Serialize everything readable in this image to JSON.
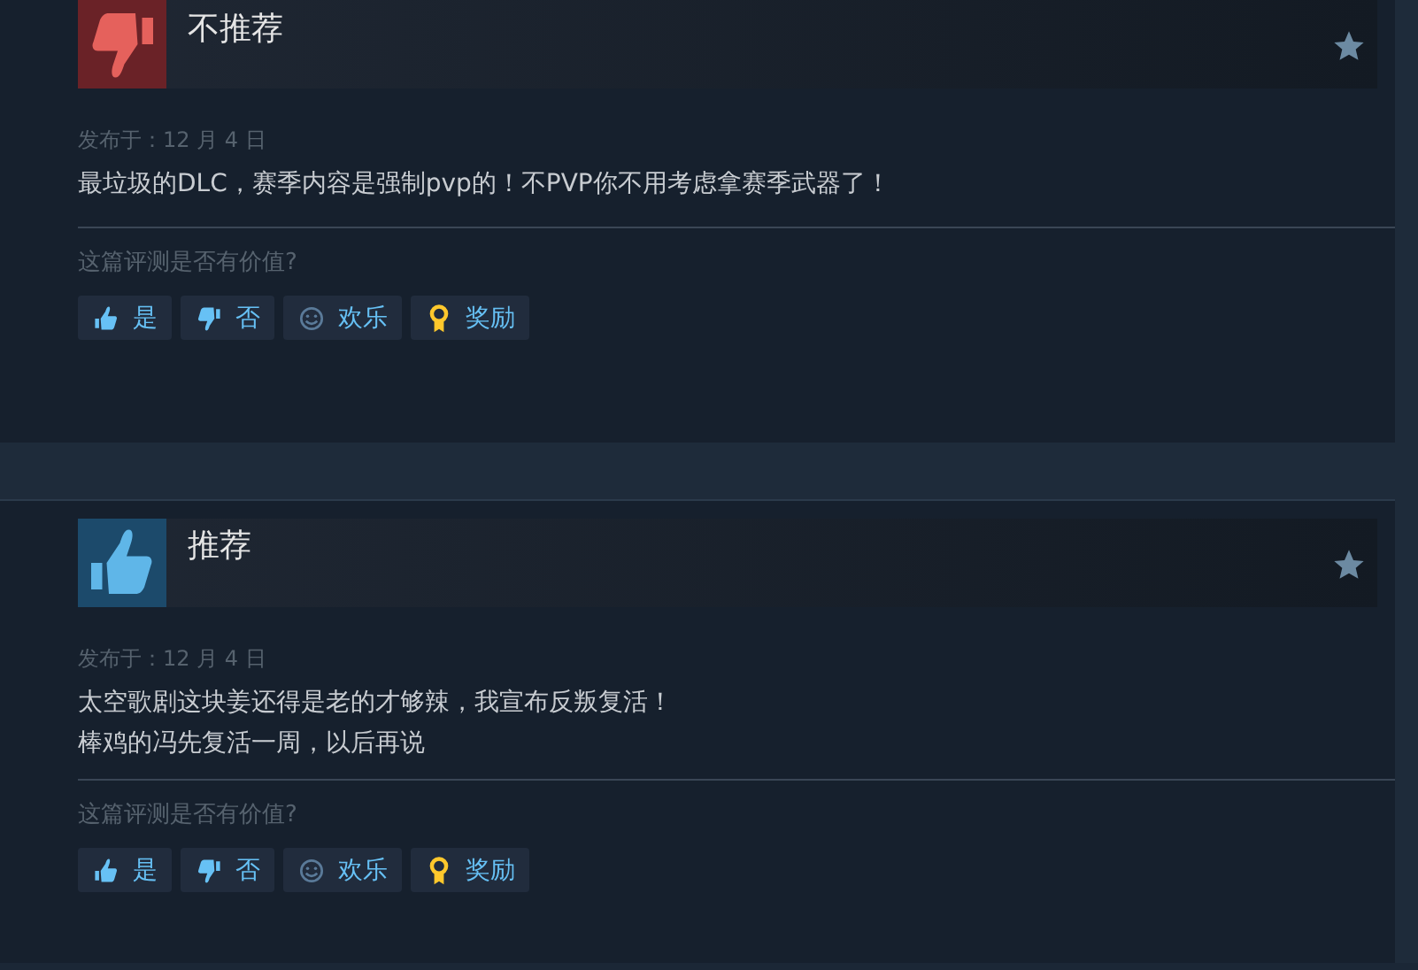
{
  "reviews": [
    {
      "recommended": false,
      "title": "不推荐",
      "date": "发布于：12 月 4 日",
      "lines": [
        "最垃圾的DLC，赛季内容是强制pvp的！不PVP你不用考虑拿赛季武器了！"
      ],
      "prompt": "这篇评测是否有价值?",
      "buttons": [
        {
          "kind": "yes",
          "label": "是"
        },
        {
          "kind": "no",
          "label": "否"
        },
        {
          "kind": "funny",
          "label": "欢乐"
        },
        {
          "kind": "award",
          "label": "奖励"
        }
      ]
    },
    {
      "recommended": true,
      "title": "推荐",
      "date": "发布于：12 月 4 日",
      "lines": [
        "太空歌剧这块姜还得是老的才够辣，我宣布反叛复活！",
        "棒鸡的冯先复活一周，以后再说"
      ],
      "prompt": "这篇评测是否有价值?",
      "buttons": [
        {
          "kind": "yes",
          "label": "是"
        },
        {
          "kind": "no",
          "label": "否"
        },
        {
          "kind": "funny",
          "label": "欢乐"
        },
        {
          "kind": "award",
          "label": "奖励"
        }
      ]
    }
  ]
}
